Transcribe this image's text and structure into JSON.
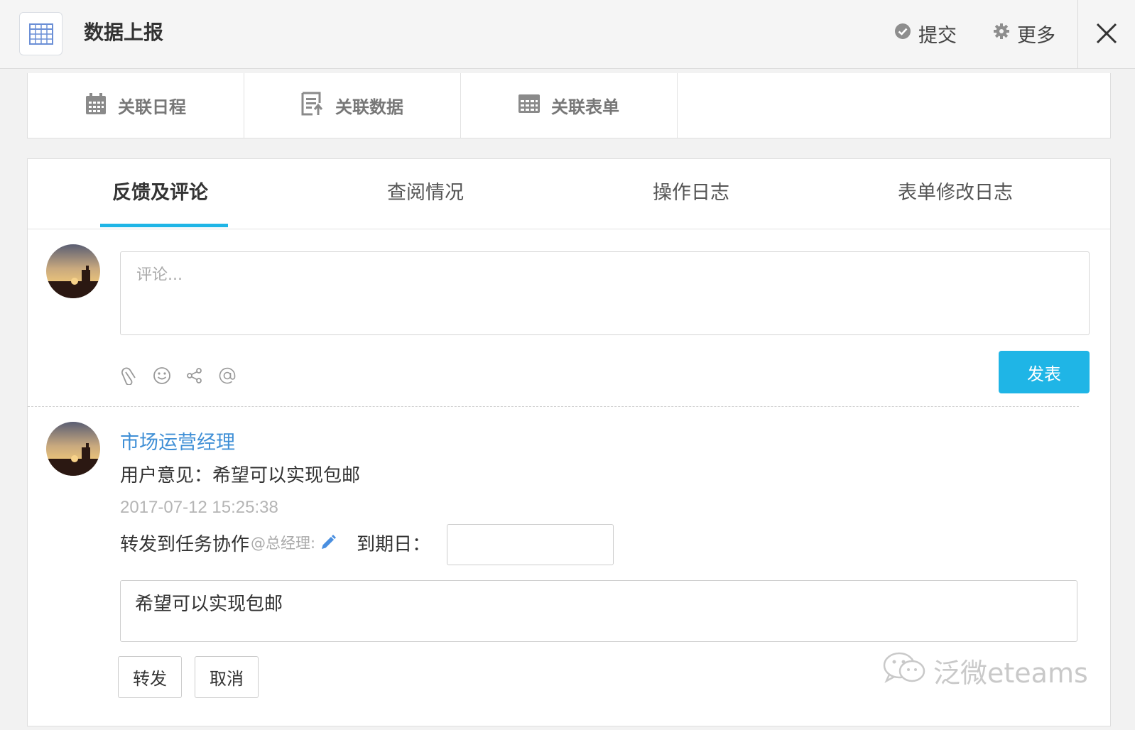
{
  "header": {
    "title": "数据上报",
    "submit_label": "提交",
    "more_label": "更多"
  },
  "link_bar": {
    "items": [
      {
        "label": "关联日程",
        "icon": "calendar-icon"
      },
      {
        "label": "关联数据",
        "icon": "data-doc-icon"
      },
      {
        "label": "关联表单",
        "icon": "table-icon"
      }
    ]
  },
  "tabs": [
    {
      "label": "反馈及评论",
      "active": true
    },
    {
      "label": "查阅情况",
      "active": false
    },
    {
      "label": "操作日志",
      "active": false
    },
    {
      "label": "表单修改日志",
      "active": false
    }
  ],
  "comment_editor": {
    "placeholder": "评论...",
    "toolbar_icons": [
      "paperclip-icon",
      "smiley-icon",
      "share-icon",
      "at-icon"
    ],
    "post_label": "发表"
  },
  "comment": {
    "author": "市场运营经理",
    "text": "用户意见：希望可以实现包邮",
    "time": "2017-07-12 15:25:38",
    "forward_label": "转发到任务协作",
    "mention": "@总经理:",
    "due_label": "到期日：",
    "due_value": "",
    "forward_text": "希望可以实现包邮",
    "forward_button": "转发",
    "cancel_button": "取消"
  },
  "watermark": {
    "text": "泛微eteams"
  },
  "colors": {
    "accent": "#1fb5e6",
    "link": "#3f8fd6"
  }
}
